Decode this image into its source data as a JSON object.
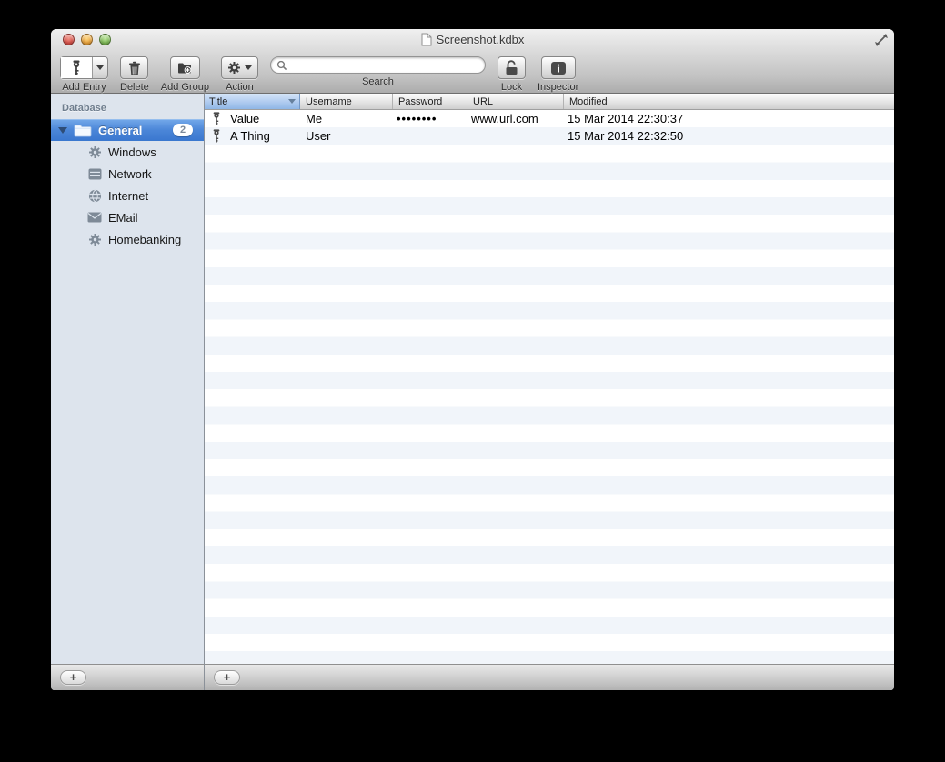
{
  "window": {
    "title": "Screenshot.kdbx"
  },
  "toolbar": {
    "add_entry_label": "Add Entry",
    "delete_label": "Delete",
    "add_group_label": "Add Group",
    "action_label": "Action",
    "search_label": "Search",
    "search_value": "",
    "lock_label": "Lock",
    "inspector_label": "Inspector"
  },
  "sidebar": {
    "header": "Database",
    "root": {
      "label": "General",
      "badge": "2"
    },
    "items": [
      {
        "label": "Windows",
        "icon": "gear-icon"
      },
      {
        "label": "Network",
        "icon": "server-icon"
      },
      {
        "label": "Internet",
        "icon": "globe-icon"
      },
      {
        "label": "EMail",
        "icon": "envelope-icon"
      },
      {
        "label": "Homebanking",
        "icon": "gear-icon"
      }
    ]
  },
  "table": {
    "columns": [
      {
        "label": "Title",
        "sorted": "desc"
      },
      {
        "label": "Username"
      },
      {
        "label": "Password"
      },
      {
        "label": "URL"
      },
      {
        "label": "Modified"
      }
    ],
    "rows": [
      {
        "title": "Value",
        "username": "Me",
        "password": "••••••••",
        "url": "www.url.com",
        "modified": "15 Mar 2014 22:30:37"
      },
      {
        "title": "A Thing",
        "username": "User",
        "password": "",
        "url": "",
        "modified": "15 Mar 2014 22:32:50"
      }
    ]
  },
  "bottom_bars": {
    "sidebar_add_label": "+",
    "main_add_label": "+"
  },
  "colors": {
    "selection_blue_top": "#74a9ea",
    "selection_blue_bottom": "#3a77cf",
    "stripe_blue": "#f1f5fa",
    "sorted_header_blue": "#9cbfe9",
    "sidebar_bg": "#dde4ed",
    "desktop_bg": "#000000"
  }
}
